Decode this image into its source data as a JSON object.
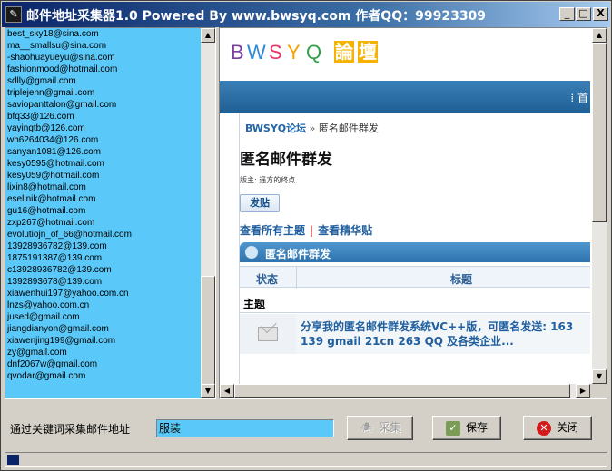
{
  "window": {
    "title": "邮件地址采集器1.0 Powered By www.bwsyq.com 作者QQ：99923309",
    "app_icon": "pen-icon",
    "minimize_glyph": "_",
    "maximize_glyph": "□",
    "close_glyph": "X"
  },
  "emails": [
    "best_sky18@sina.com",
    "ma__smallsu@sina.com",
    "-shaohuayueyu@sina.com",
    "fashionmood@hotmail.com",
    "sdlly@gmail.com",
    "triplejenn@gmail.com",
    "saviopanttalon@gmail.com",
    "bfq33@126.com",
    "yayingtb@126.com",
    "wh6264034@126.com",
    "sanyan1081@126.com",
    "kesy0595@hotmail.com",
    "kesy059@hotmail.com",
    "lixin8@hotmail.com",
    "esellnik@hotmail.com",
    "gu16@hotmail.com",
    "zxp267@hotmail.com",
    "evolutiojn_of_66@hotmail.com",
    "13928936782@139.com",
    "1875191387@139.com",
    "c13928936782@139.com",
    "1392893678@139.com",
    "xiawenhui197@yahoo.com.cn",
    "lnzs@yahoo.com.cn",
    "jused@gmail.com",
    "jiangdianyon@gmail.com",
    "xiawenjing199@gmail.com",
    "zy@gmail.com",
    "dnf2067w@gmail.com",
    "qvodar@gmail.com"
  ],
  "browser": {
    "logo_letters": [
      "B",
      "W",
      "S",
      "Y",
      "Q"
    ],
    "logo_colors": [
      "#7b3fa0",
      "#2e8ad8",
      "#e8356b",
      "#f5a100",
      "#35a04a"
    ],
    "logo_cjk": [
      "論",
      "壇"
    ],
    "band_right_glyph": "⁞ 首",
    "breadcrumb": {
      "home": "BWSYQ论坛",
      "sep": "»",
      "current": "匿名邮件群发"
    },
    "heading": "匿名邮件群发",
    "moderator": "版主: 遥方的终点",
    "post_button": "发贴",
    "link_all": "查看所有主题",
    "link_pipe": "|",
    "link_digest": "查看精华贴",
    "forum_title": "匿名邮件群发",
    "col_status": "状态",
    "col_title": "标题",
    "section_label": "主题",
    "topic": "分享我的匿名邮件群发系统VC++版，可匿名发送: 163 139 gmail 21cn 263 QQ 及各类企业...",
    "topic_icon": "envelope-icon"
  },
  "controls": {
    "keyword_label": "通过关键词采集邮件地址",
    "keyword_value": "服装",
    "collect_label": "采集",
    "collect_icon": "collect-icon",
    "save_label": "保存",
    "save_icon": "save-icon",
    "close_label": "关闭",
    "close_icon": "close-icon"
  },
  "status": {
    "progress": 0.02
  }
}
